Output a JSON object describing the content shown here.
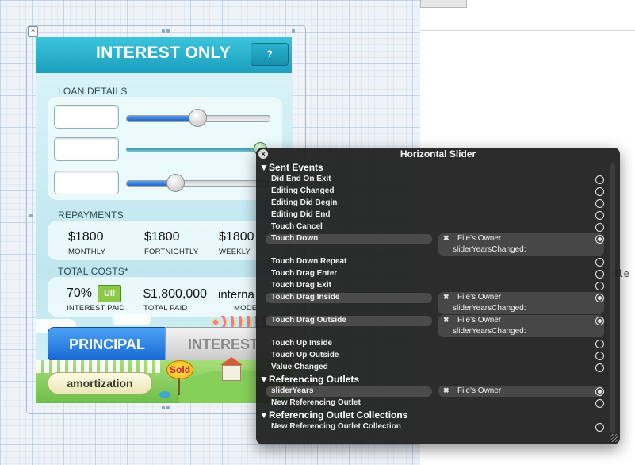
{
  "app": {
    "title": "INTEREST ONLY",
    "help_label": "?",
    "right_code_fragment": "dle",
    "canvas_close_glyph": "×",
    "canvas_handles_glyph": "•••"
  },
  "loan_details": {
    "label": "LOAN DETAILS",
    "fields": [
      {
        "value": "",
        "slider_level": 0.55
      },
      {
        "value": "",
        "slider_level": 1.0
      },
      {
        "value": "",
        "slider_level": 0.35
      }
    ]
  },
  "repayments": {
    "label": "REPAYMENTS",
    "items": [
      {
        "amount": "$1800",
        "caption": "MONTHLY"
      },
      {
        "amount": "$1800",
        "caption": "FORTNIGHTLY"
      },
      {
        "amount": "$1800",
        "caption": "WEEKLY"
      }
    ]
  },
  "total_costs": {
    "label": "TOTAL COSTS*",
    "interest_pct": "70%",
    "badge": "UII",
    "interest_caption": "INTEREST PAID",
    "total_amount": "$1,800,000",
    "total_caption": "TOTAL PAID",
    "mode_value": "interna",
    "mode_caption": "MODE"
  },
  "toggle": {
    "principal": "PRINCIPAL",
    "interest": "INTEREST"
  },
  "footer": {
    "amortization": "amortization",
    "sold": "Sold"
  },
  "hud": {
    "title": "Horizontal Slider",
    "close_glyph": "×",
    "sections": [
      {
        "title": "Sent Events",
        "rows": [
          {
            "label": "Did End On Exit",
            "connected": false
          },
          {
            "label": "Editing Changed",
            "connected": false
          },
          {
            "label": "Editing Did Begin",
            "connected": false
          },
          {
            "label": "Editing Did End",
            "connected": false
          },
          {
            "label": "Touch Cancel",
            "connected": false
          },
          {
            "label": "Touch Down",
            "connected": true,
            "target": "File's Owner",
            "action": "sliderYearsChanged:"
          },
          {
            "label": "Touch Down Repeat",
            "connected": false
          },
          {
            "label": "Touch Drag Enter",
            "connected": false
          },
          {
            "label": "Touch Drag Exit",
            "connected": false
          },
          {
            "label": "Touch Drag Inside",
            "connected": true,
            "target": "File's Owner",
            "action": "sliderYearsChanged:"
          },
          {
            "label": "Touch Drag Outside",
            "connected": true,
            "target": "File's Owner",
            "action": "sliderYearsChanged:"
          },
          {
            "label": "Touch Up Inside",
            "connected": false
          },
          {
            "label": "Touch Up Outside",
            "connected": false
          },
          {
            "label": "Value Changed",
            "connected": false
          }
        ]
      },
      {
        "title": "Referencing Outlets",
        "rows": [
          {
            "label": "sliderYears",
            "connected": true,
            "target": "File's Owner"
          },
          {
            "label": "New Referencing Outlet",
            "connected": false
          }
        ]
      },
      {
        "title": "Referencing Outlet Collections",
        "rows": [
          {
            "label": "New Referencing Outlet Collection",
            "connected": false
          }
        ]
      }
    ]
  },
  "icons": {
    "close": "close-icon",
    "disclosure": "disclosure-triangle-icon",
    "connection_dot": "connection-circle-icon",
    "remove_connection": "remove-connection-icon",
    "resize": "resize-grip-icon"
  },
  "colors": {
    "header": "#1b9fbe",
    "principal": "#1766d3",
    "badge": "#8cc84a",
    "hud_bg": "#1c1c1c"
  }
}
